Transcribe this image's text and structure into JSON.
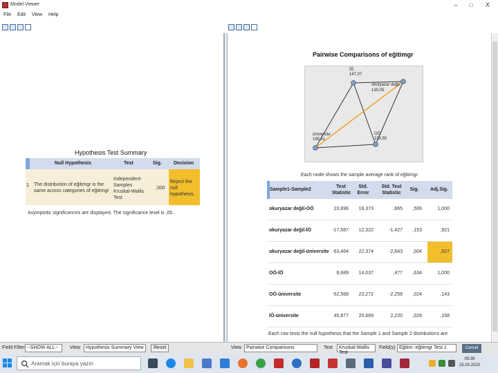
{
  "window": {
    "title": "Model Viewer"
  },
  "window_controls": {
    "minimize": "–",
    "maximize": "□",
    "close": "X"
  },
  "menu": [
    "File",
    "Edit",
    "View",
    "Help"
  ],
  "left": {
    "title": "Hypothesis Test Summary",
    "headers": [
      "Null Hypothesis",
      "Test",
      "Sig.",
      "Decision"
    ],
    "row": {
      "num": "1",
      "hypothesis": "The distribution of eğitimgr is the same across categories of eğitimgr",
      "test": "Independent-Samples Kruskal-Wallis Test",
      "sig": ",000",
      "decision": "Reject the null hypothesis."
    },
    "footnote": "Asymptotic significances are displayed. The significance level is ,05."
  },
  "right": {
    "title": "Pairwise Comparisons of eğitimgr",
    "nodes": [
      {
        "name": "İÖ",
        "value": "147,07"
      },
      {
        "name": "okuryazar değil",
        "value": "130,05"
      },
      {
        "name": "üniversite",
        "value": "195,51"
      },
      {
        "name": "OÖ",
        "value": "100,55"
      }
    ],
    "note": "Each node shows the sample average rank of eğitimgr.",
    "headers": [
      "Sample1-Sample2",
      "Test Statistic",
      "Std. Error",
      "Std. Test Statistic",
      "Sig.",
      "Adj.Sig."
    ],
    "rows": [
      {
        "label": "okuryazar değil-OÖ",
        "stat": "10,896",
        "err": "16,373",
        "std": ",665",
        "sig": ",506",
        "adj": "1,000",
        "hl": false
      },
      {
        "label": "okuryazar değil-İÖ",
        "stat": "-17,587",
        "err": "12,322",
        "std": "-1,427",
        "sig": ",153",
        "adj": ",921",
        "hl": false
      },
      {
        "label": "okuryazar değil-üniversite",
        "stat": "-63,464",
        "err": "22,374",
        "std": "-2,843",
        "sig": ",004",
        "adj": ",027",
        "hl": true
      },
      {
        "label": "OÖ-İÖ",
        "stat": "6,689",
        "err": "14,037",
        "std": ",477",
        "sig": ",634",
        "adj": "1,000",
        "hl": false
      },
      {
        "label": "OÖ-üniversite",
        "stat": "-52,568",
        "err": "23,272",
        "std": "-2,259",
        "sig": ",024",
        "adj": ",143",
        "hl": false
      },
      {
        "label": "İÖ-üniversite",
        "stat": "45,877",
        "err": "20,669",
        "std": "2,220",
        "sig": ",026",
        "adj": ",158",
        "hl": false
      }
    ],
    "footnote": "Each row tests the null hypothesis that the Sample 1 and Sample 2 distributions are"
  },
  "bottom": {
    "field_filter_label": "Field Filter",
    "field_filter_value": "--SHOW ALL--",
    "view_label": "View",
    "view_value": "Hypothesis Summary View",
    "reset": "Reset",
    "view2_label": "View",
    "view2_value": "Pairwise Comparisons",
    "test_label": "Test",
    "test_value": "Kruskal-Wallis Test",
    "field_label": "Field(s)",
    "field_value": "Eğitim: eğitimgr Test 1",
    "cancel": "Cancel"
  },
  "taskbar": {
    "search_placeholder": "Aramak için buraya yazın",
    "time": "09:39",
    "date": "25.03.2020"
  },
  "colors": {
    "accent": "#f2be2c",
    "header": "#d3dcec",
    "row": "#f6eed8"
  }
}
